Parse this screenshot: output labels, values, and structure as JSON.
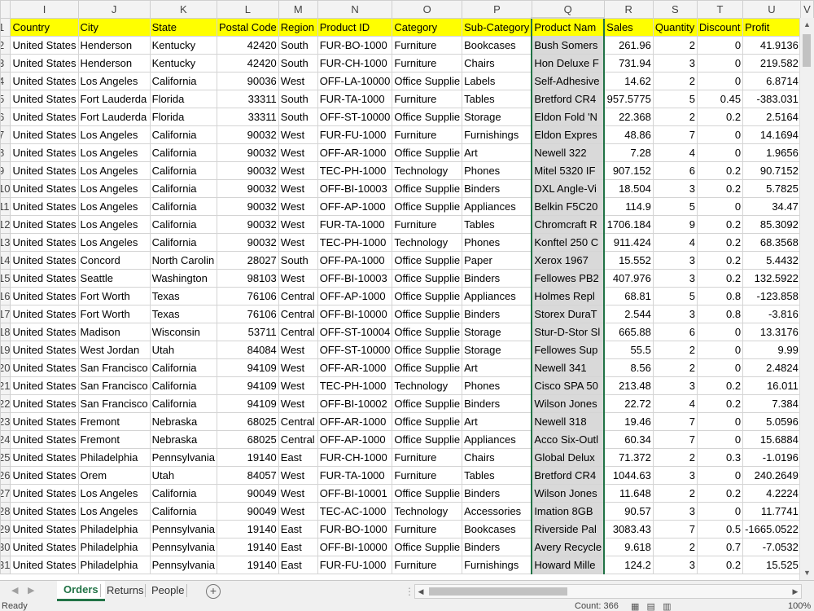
{
  "columns": [
    "I",
    "J",
    "K",
    "L",
    "M",
    "N",
    "O",
    "P",
    "Q",
    "R",
    "S",
    "T",
    "U",
    "V"
  ],
  "header_row": {
    "num": "1",
    "cells": [
      "Country",
      "City",
      "State",
      "Postal Code",
      "Region",
      "Product ID",
      "Category",
      "Sub-Category",
      "Product Nam",
      "Sales",
      "Quantity",
      "Discount",
      "Profit",
      ""
    ]
  },
  "rows": [
    {
      "num": "2",
      "cells": [
        "United States",
        "Henderson",
        "Kentucky",
        "42420",
        "South",
        "FUR-BO-1000",
        "Furniture",
        "Bookcases",
        "Bush Somers",
        "261.96",
        "2",
        "0",
        "41.9136"
      ]
    },
    {
      "num": "3",
      "cells": [
        "United States",
        "Henderson",
        "Kentucky",
        "42420",
        "South",
        "FUR-CH-1000",
        "Furniture",
        "Chairs",
        "Hon Deluxe F",
        "731.94",
        "3",
        "0",
        "219.582"
      ]
    },
    {
      "num": "4",
      "cells": [
        "United States",
        "Los Angeles",
        "California",
        "90036",
        "West",
        "OFF-LA-10000",
        "Office Supplie",
        "Labels",
        "Self-Adhesive",
        "14.62",
        "2",
        "0",
        "6.8714"
      ]
    },
    {
      "num": "5",
      "cells": [
        "United States",
        "Fort Lauderda",
        "Florida",
        "33311",
        "South",
        "FUR-TA-1000",
        "Furniture",
        "Tables",
        "Bretford CR4",
        "957.5775",
        "5",
        "0.45",
        "-383.031"
      ]
    },
    {
      "num": "6",
      "cells": [
        "United States",
        "Fort Lauderda",
        "Florida",
        "33311",
        "South",
        "OFF-ST-10000",
        "Office Supplie",
        "Storage",
        "Eldon Fold 'N",
        "22.368",
        "2",
        "0.2",
        "2.5164"
      ]
    },
    {
      "num": "7",
      "cells": [
        "United States",
        "Los Angeles",
        "California",
        "90032",
        "West",
        "FUR-FU-1000",
        "Furniture",
        "Furnishings",
        "Eldon Expres",
        "48.86",
        "7",
        "0",
        "14.1694"
      ]
    },
    {
      "num": "8",
      "cells": [
        "United States",
        "Los Angeles",
        "California",
        "90032",
        "West",
        "OFF-AR-1000",
        "Office Supplie",
        "Art",
        "Newell 322",
        "7.28",
        "4",
        "0",
        "1.9656"
      ]
    },
    {
      "num": "9",
      "cells": [
        "United States",
        "Los Angeles",
        "California",
        "90032",
        "West",
        "TEC-PH-1000",
        "Technology",
        "Phones",
        "Mitel 5320 IF",
        "907.152",
        "6",
        "0.2",
        "90.7152"
      ]
    },
    {
      "num": "10",
      "cells": [
        "United States",
        "Los Angeles",
        "California",
        "90032",
        "West",
        "OFF-BI-10003",
        "Office Supplie",
        "Binders",
        "DXL Angle-Vi",
        "18.504",
        "3",
        "0.2",
        "5.7825"
      ]
    },
    {
      "num": "11",
      "cells": [
        "United States",
        "Los Angeles",
        "California",
        "90032",
        "West",
        "OFF-AP-1000",
        "Office Supplie",
        "Appliances",
        "Belkin F5C20",
        "114.9",
        "5",
        "0",
        "34.47"
      ]
    },
    {
      "num": "12",
      "cells": [
        "United States",
        "Los Angeles",
        "California",
        "90032",
        "West",
        "FUR-TA-1000",
        "Furniture",
        "Tables",
        "Chromcraft R",
        "1706.184",
        "9",
        "0.2",
        "85.3092"
      ]
    },
    {
      "num": "13",
      "cells": [
        "United States",
        "Los Angeles",
        "California",
        "90032",
        "West",
        "TEC-PH-1000",
        "Technology",
        "Phones",
        "Konftel 250 C",
        "911.424",
        "4",
        "0.2",
        "68.3568"
      ]
    },
    {
      "num": "14",
      "cells": [
        "United States",
        "Concord",
        "North Carolin",
        "28027",
        "South",
        "OFF-PA-1000",
        "Office Supplie",
        "Paper",
        "Xerox 1967",
        "15.552",
        "3",
        "0.2",
        "5.4432"
      ]
    },
    {
      "num": "15",
      "cells": [
        "United States",
        "Seattle",
        "Washington",
        "98103",
        "West",
        "OFF-BI-10003",
        "Office Supplie",
        "Binders",
        "Fellowes PB2",
        "407.976",
        "3",
        "0.2",
        "132.5922"
      ]
    },
    {
      "num": "16",
      "cells": [
        "United States",
        "Fort Worth",
        "Texas",
        "76106",
        "Central",
        "OFF-AP-1000",
        "Office Supplie",
        "Appliances",
        "Holmes Repl",
        "68.81",
        "5",
        "0.8",
        "-123.858"
      ]
    },
    {
      "num": "17",
      "cells": [
        "United States",
        "Fort Worth",
        "Texas",
        "76106",
        "Central",
        "OFF-BI-10000",
        "Office Supplie",
        "Binders",
        "Storex DuraT",
        "2.544",
        "3",
        "0.8",
        "-3.816"
      ]
    },
    {
      "num": "18",
      "cells": [
        "United States",
        "Madison",
        "Wisconsin",
        "53711",
        "Central",
        "OFF-ST-10004",
        "Office Supplie",
        "Storage",
        "Stur-D-Stor Sl",
        "665.88",
        "6",
        "0",
        "13.3176"
      ]
    },
    {
      "num": "19",
      "cells": [
        "United States",
        "West Jordan",
        "Utah",
        "84084",
        "West",
        "OFF-ST-10000",
        "Office Supplie",
        "Storage",
        "Fellowes Sup",
        "55.5",
        "2",
        "0",
        "9.99"
      ]
    },
    {
      "num": "20",
      "cells": [
        "United States",
        "San Francisco",
        "California",
        "94109",
        "West",
        "OFF-AR-1000",
        "Office Supplie",
        "Art",
        "Newell 341",
        "8.56",
        "2",
        "0",
        "2.4824"
      ]
    },
    {
      "num": "21",
      "cells": [
        "United States",
        "San Francisco",
        "California",
        "94109",
        "West",
        "TEC-PH-1000",
        "Technology",
        "Phones",
        "Cisco SPA 50",
        "213.48",
        "3",
        "0.2",
        "16.011"
      ]
    },
    {
      "num": "22",
      "cells": [
        "United States",
        "San Francisco",
        "California",
        "94109",
        "West",
        "OFF-BI-10002",
        "Office Supplie",
        "Binders",
        "Wilson Jones",
        "22.72",
        "4",
        "0.2",
        "7.384"
      ]
    },
    {
      "num": "23",
      "cells": [
        "United States",
        "Fremont",
        "Nebraska",
        "68025",
        "Central",
        "OFF-AR-1000",
        "Office Supplie",
        "Art",
        "Newell 318",
        "19.46",
        "7",
        "0",
        "5.0596"
      ]
    },
    {
      "num": "24",
      "cells": [
        "United States",
        "Fremont",
        "Nebraska",
        "68025",
        "Central",
        "OFF-AP-1000",
        "Office Supplie",
        "Appliances",
        "Acco Six-Outl",
        "60.34",
        "7",
        "0",
        "15.6884"
      ]
    },
    {
      "num": "25",
      "cells": [
        "United States",
        "Philadelphia",
        "Pennsylvania",
        "19140",
        "East",
        "FUR-CH-1000",
        "Furniture",
        "Chairs",
        "Global Delux",
        "71.372",
        "2",
        "0.3",
        "-1.0196"
      ]
    },
    {
      "num": "26",
      "cells": [
        "United States",
        "Orem",
        "Utah",
        "84057",
        "West",
        "FUR-TA-1000",
        "Furniture",
        "Tables",
        "Bretford CR4",
        "1044.63",
        "3",
        "0",
        "240.2649"
      ]
    },
    {
      "num": "27",
      "cells": [
        "United States",
        "Los Angeles",
        "California",
        "90049",
        "West",
        "OFF-BI-10001",
        "Office Supplie",
        "Binders",
        "Wilson Jones",
        "11.648",
        "2",
        "0.2",
        "4.2224"
      ]
    },
    {
      "num": "28",
      "cells": [
        "United States",
        "Los Angeles",
        "California",
        "90049",
        "West",
        "TEC-AC-1000",
        "Technology",
        "Accessories",
        "Imation 8GB",
        "90.57",
        "3",
        "0",
        "11.7741"
      ]
    },
    {
      "num": "29",
      "cells": [
        "United States",
        "Philadelphia",
        "Pennsylvania",
        "19140",
        "East",
        "FUR-BO-1000",
        "Furniture",
        "Bookcases",
        "Riverside Pal",
        "3083.43",
        "7",
        "0.5",
        "-1665.0522"
      ]
    },
    {
      "num": "30",
      "cells": [
        "United States",
        "Philadelphia",
        "Pennsylvania",
        "19140",
        "East",
        "OFF-BI-10000",
        "Office Supplie",
        "Binders",
        "Avery Recycle",
        "9.618",
        "2",
        "0.7",
        "-7.0532"
      ]
    },
    {
      "num": "31",
      "cells": [
        "United States",
        "Philadelphia",
        "Pennsylvania",
        "19140",
        "East",
        "FUR-FU-1000",
        "Furniture",
        "Furnishings",
        "Howard Mille",
        "124.2",
        "3",
        "0.2",
        "15.525"
      ]
    }
  ],
  "tabs": {
    "orders": "Orders",
    "returns": "Returns",
    "people": "People",
    "add": "+"
  },
  "status": {
    "ready": "Ready",
    "count": "Count: 366",
    "zoom": "100%"
  },
  "colors": {
    "header_fill": "#ffff00",
    "selected_column_fill": "#d9d9d9",
    "excel_green": "#217346"
  }
}
